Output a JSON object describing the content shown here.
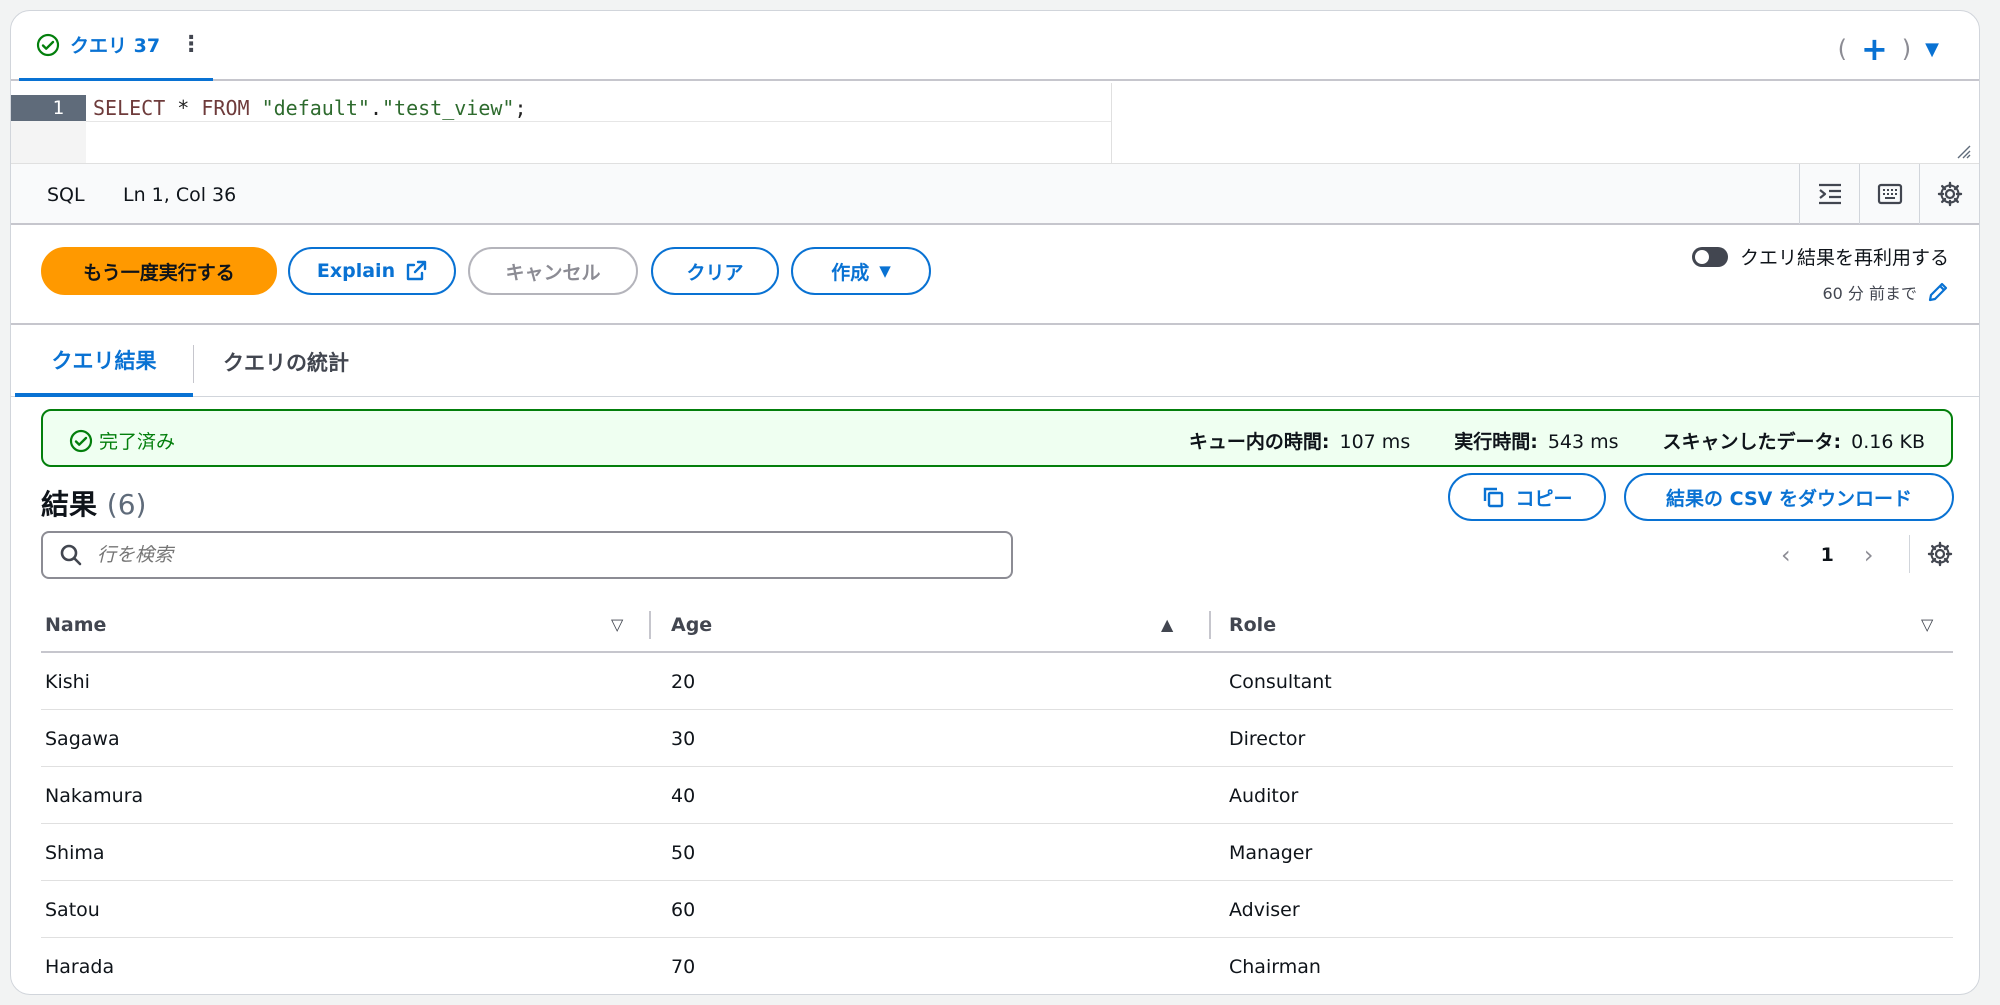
{
  "tab": {
    "label": "クエリ 37"
  },
  "tab_actions": {
    "open_paren": "(",
    "plus": "+",
    "close_paren": ")"
  },
  "editor": {
    "line_number": "1",
    "code_parts": [
      "SELECT",
      " * ",
      "FROM",
      " ",
      "\"default\"",
      ".",
      "\"test_view\"",
      ";"
    ]
  },
  "statusbar": {
    "language": "SQL",
    "position": "Ln 1, Col 36"
  },
  "actions": {
    "run_again": "もう一度実行する",
    "explain": "Explain",
    "cancel": "キャンセル",
    "clear": "クリア",
    "create": "作成",
    "reuse_label": "クエリ結果を再利用する",
    "reuse_duration": "60 分 前まで"
  },
  "result_tabs": {
    "results": "クエリ結果",
    "stats": "クエリの統計"
  },
  "banner": {
    "status": "完了済み",
    "queue_label": "キュー内の時間:",
    "queue_value": "107 ms",
    "run_label": "実行時間:",
    "run_value": "543 ms",
    "scan_label": "スキャンしたデータ:",
    "scan_value": "0.16 KB"
  },
  "results": {
    "title": "結果",
    "count": "(6)",
    "copy": "コピー",
    "download": "結果の CSV をダウンロード",
    "search_placeholder": "行を検索",
    "page": "1"
  },
  "table": {
    "headers": [
      "Name",
      "Age",
      "Role"
    ],
    "rows": [
      [
        "Kishi",
        "20",
        "Consultant"
      ],
      [
        "Sagawa",
        "30",
        "Director"
      ],
      [
        "Nakamura",
        "40",
        "Auditor"
      ],
      [
        "Shima",
        "50",
        "Manager"
      ],
      [
        "Satou",
        "60",
        "Adviser"
      ],
      [
        "Harada",
        "70",
        "Chairman"
      ]
    ]
  },
  "colors": {
    "accent": "#0972d3",
    "primary_button": "#ff9900",
    "success": "#037f0c",
    "success_bg": "#effff1"
  }
}
